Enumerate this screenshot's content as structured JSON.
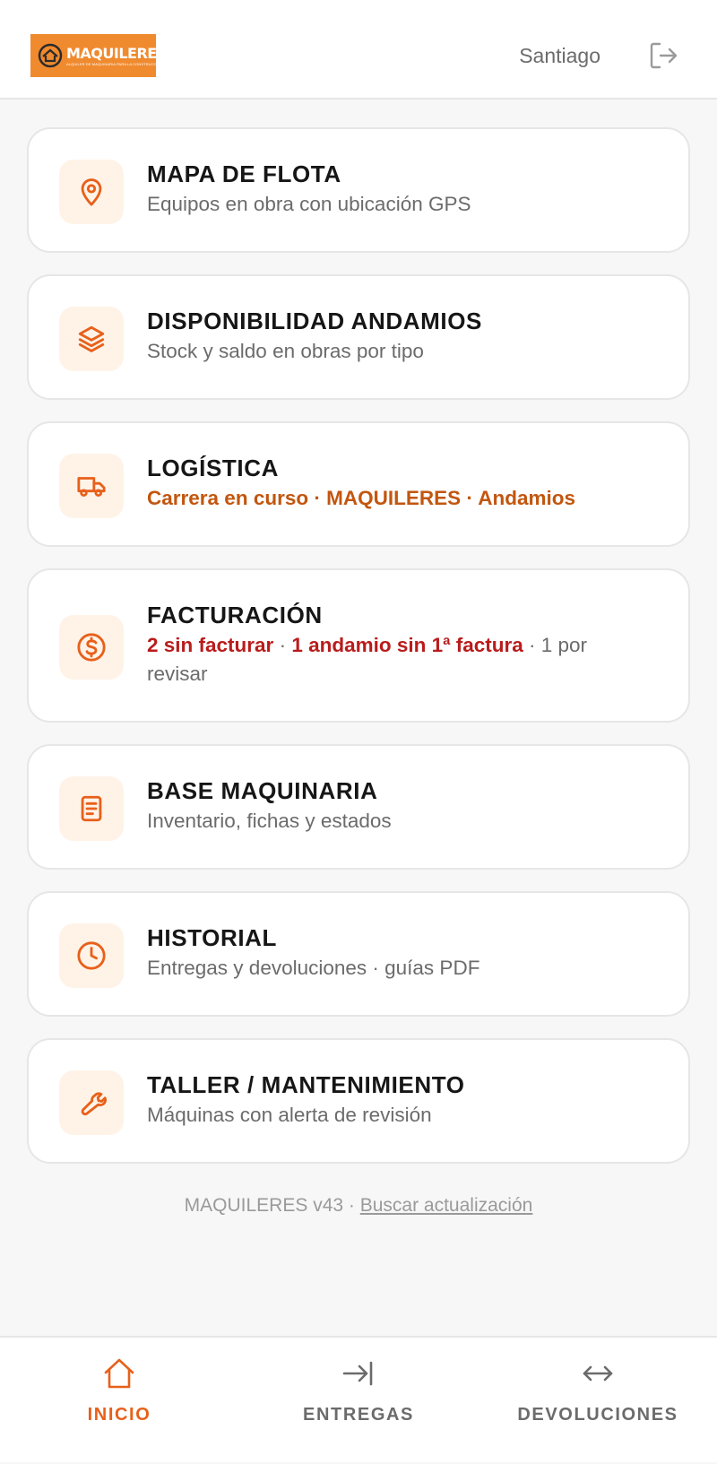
{
  "header": {
    "logo_name": "MAQUILERES",
    "logo_tagline": "ALQUILER DE MAQUINARIA PARA LA CONSTRUCCIÓN",
    "user": "Santiago",
    "logout_icon": "logout-icon"
  },
  "cards": [
    {
      "title": "MAPA DE FLOTA",
      "subtitle": "Equipos en obra con ubicación GPS",
      "icon": "map-pin-icon"
    },
    {
      "title": "DISPONIBILIDAD ANDAMIOS",
      "subtitle": "Stock y saldo en obras por tipo",
      "icon": "layers-icon"
    },
    {
      "title": "LOGÍSTICA",
      "alert": "Carrera en curso · MAQUILERES · Andamios",
      "icon": "truck-icon"
    },
    {
      "title": "FACTURACIÓN",
      "billing": {
        "unbilled": "2 sin facturar",
        "sep1": " · ",
        "scaffold": "1 andamio sin 1ª factura",
        "sep2": " · ",
        "review": "1 por revisar"
      },
      "icon": "dollar-icon"
    },
    {
      "title": "BASE MAQUINARIA",
      "subtitle": "Inventario, fichas y estados",
      "icon": "document-icon"
    },
    {
      "title": "HISTORIAL",
      "subtitle": "Entregas y devoluciones · guías PDF",
      "icon": "clock-icon"
    },
    {
      "title": "TALLER / MANTENIMIENTO",
      "subtitle": "Máquinas con alerta de revisión",
      "icon": "wrench-icon"
    }
  ],
  "footer": {
    "version": "MAQUILERES v43 · ",
    "update_link": "Buscar actualización"
  },
  "tabs": [
    {
      "label": "INICIO",
      "icon": "home-icon",
      "active": true
    },
    {
      "label": "ENTREGAS",
      "icon": "arrow-right-bar-icon",
      "active": false
    },
    {
      "label": "DEVOLUCIONES",
      "icon": "arrows-horizontal-icon",
      "active": false
    }
  ],
  "colors": {
    "accent": "#e8601a",
    "alert": "#c2560f",
    "danger": "#b91c1c",
    "logo_bg": "#f08a2e"
  }
}
